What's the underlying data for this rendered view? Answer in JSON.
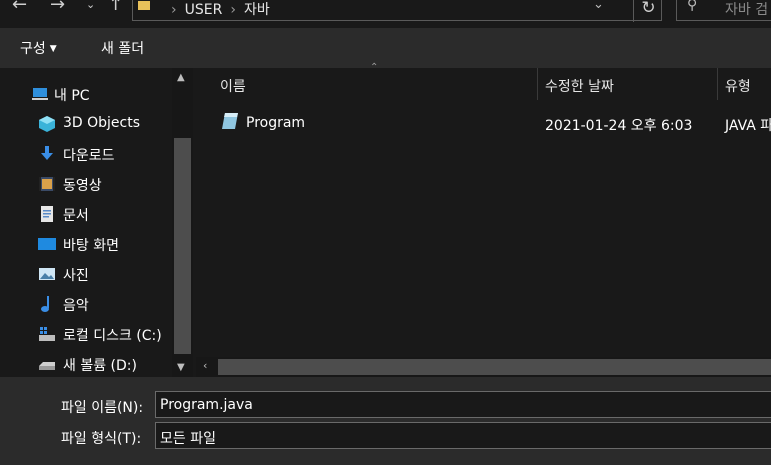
{
  "window": {
    "back_icon": "arrow-left-icon",
    "forward_icon": "arrow-right-icon",
    "recent_icon": "chevron-down-icon",
    "up_icon": "arrow-up-icon"
  },
  "address": {
    "crumbs": [
      "USER",
      "자바"
    ],
    "refresh_icon": "refresh-icon"
  },
  "search": {
    "placeholder": "자바 검"
  },
  "toolbar": {
    "organize_label": "구성",
    "new_folder_label": "새 폴더"
  },
  "sidebar": {
    "items": [
      {
        "label": "내 PC",
        "icon": "pc-icon"
      },
      {
        "label": "3D Objects",
        "icon": "cube-icon"
      },
      {
        "label": "다운로드",
        "icon": "download-icon"
      },
      {
        "label": "동영상",
        "icon": "video-icon"
      },
      {
        "label": "문서",
        "icon": "document-icon"
      },
      {
        "label": "바탕 화면",
        "icon": "desktop-icon"
      },
      {
        "label": "사진",
        "icon": "picture-icon"
      },
      {
        "label": "음악",
        "icon": "music-icon"
      },
      {
        "label": "로컬 디스크 (C:)",
        "icon": "disk-icon"
      },
      {
        "label": "새 볼륨 (D:)",
        "icon": "drive-icon"
      }
    ]
  },
  "filelist": {
    "columns": [
      "이름",
      "수정한 날짜",
      "유형"
    ],
    "rows": [
      {
        "name": "Program",
        "modified": "2021-01-24 오후 6:03",
        "type": "JAVA 파"
      }
    ]
  },
  "save": {
    "filename_label": "파일 이름(N):",
    "filename_value": "Program.java",
    "filetype_label": "파일 형식(T):",
    "filetype_value": "모든 파일"
  },
  "colors": {
    "background": "#191919",
    "bar": "#2b2b2b",
    "scroll_thumb": "#4d4d4d"
  }
}
